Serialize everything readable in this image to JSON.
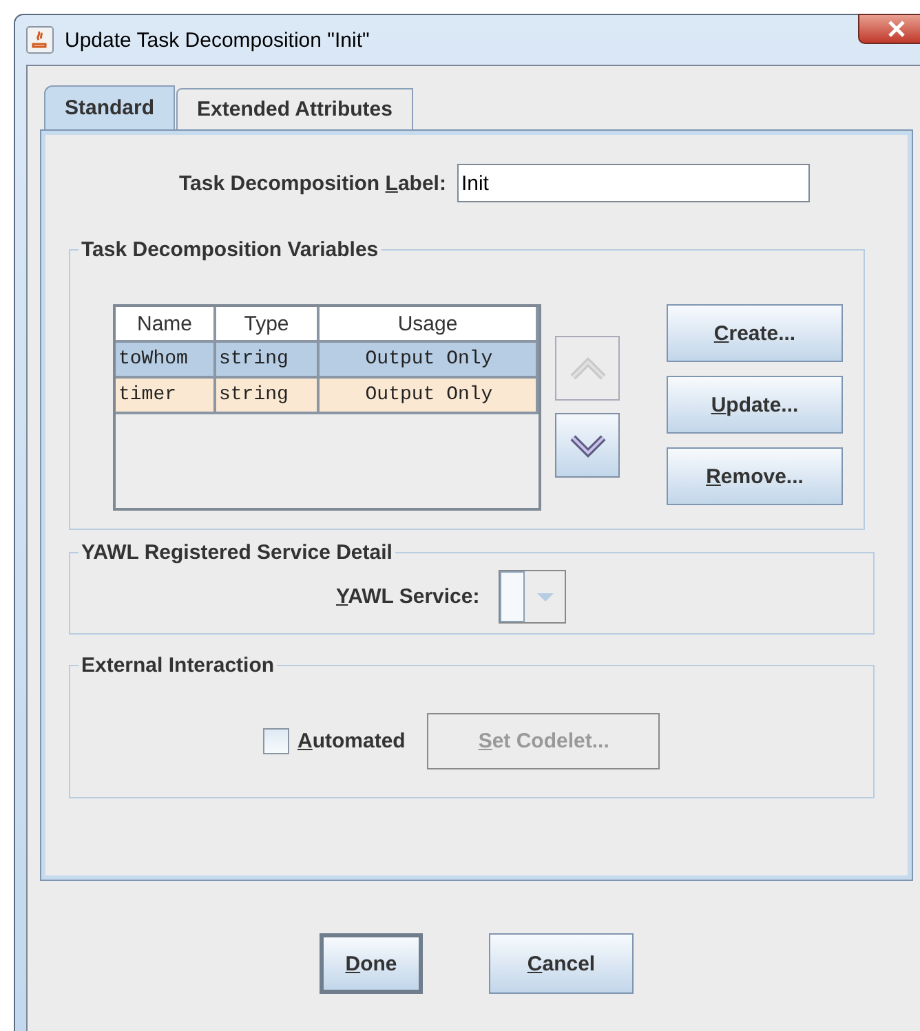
{
  "window": {
    "title": "Update Task Decomposition  \"Init\""
  },
  "tabs": [
    {
      "label": "Standard",
      "selected": true
    },
    {
      "label": "Extended Attributes",
      "selected": false
    }
  ],
  "label_field": {
    "label": {
      "pre": "Task Decomposition ",
      "key": "L",
      "post": "abel:"
    },
    "value": "Init"
  },
  "variables": {
    "title": "Task Decomposition Variables",
    "columns": [
      "Name",
      "Type",
      "Usage"
    ],
    "rows": [
      {
        "cells": [
          "toWhom",
          "string",
          "Output Only"
        ],
        "selected": true
      },
      {
        "cells": [
          "timer",
          "string",
          "Output Only"
        ],
        "selected": false
      }
    ],
    "move_buttons": [
      {
        "kind": "up",
        "disabled": true
      },
      {
        "kind": "down",
        "disabled": false
      }
    ],
    "buttons": [
      {
        "label": {
          "key": "C",
          "post": "reate..."
        }
      },
      {
        "label": {
          "key": "U",
          "post": "pdate..."
        }
      },
      {
        "label": {
          "key": "R",
          "post": "emove..."
        }
      }
    ]
  },
  "service": {
    "title": "YAWL Registered Service Detail",
    "label": {
      "key": "Y",
      "post": "AWL Service:"
    }
  },
  "external": {
    "title": "External Interaction",
    "checkbox": {
      "label": {
        "key": "A",
        "post": "utomated"
      },
      "checked": false
    },
    "button": {
      "label": {
        "key": "S",
        "post": "et Codelet..."
      },
      "disabled": true
    }
  },
  "footer_buttons": [
    {
      "label": {
        "key": "D",
        "post": "one"
      },
      "default": true
    },
    {
      "label": {
        "key": "C",
        "post": "ancel"
      },
      "default": false
    }
  ]
}
